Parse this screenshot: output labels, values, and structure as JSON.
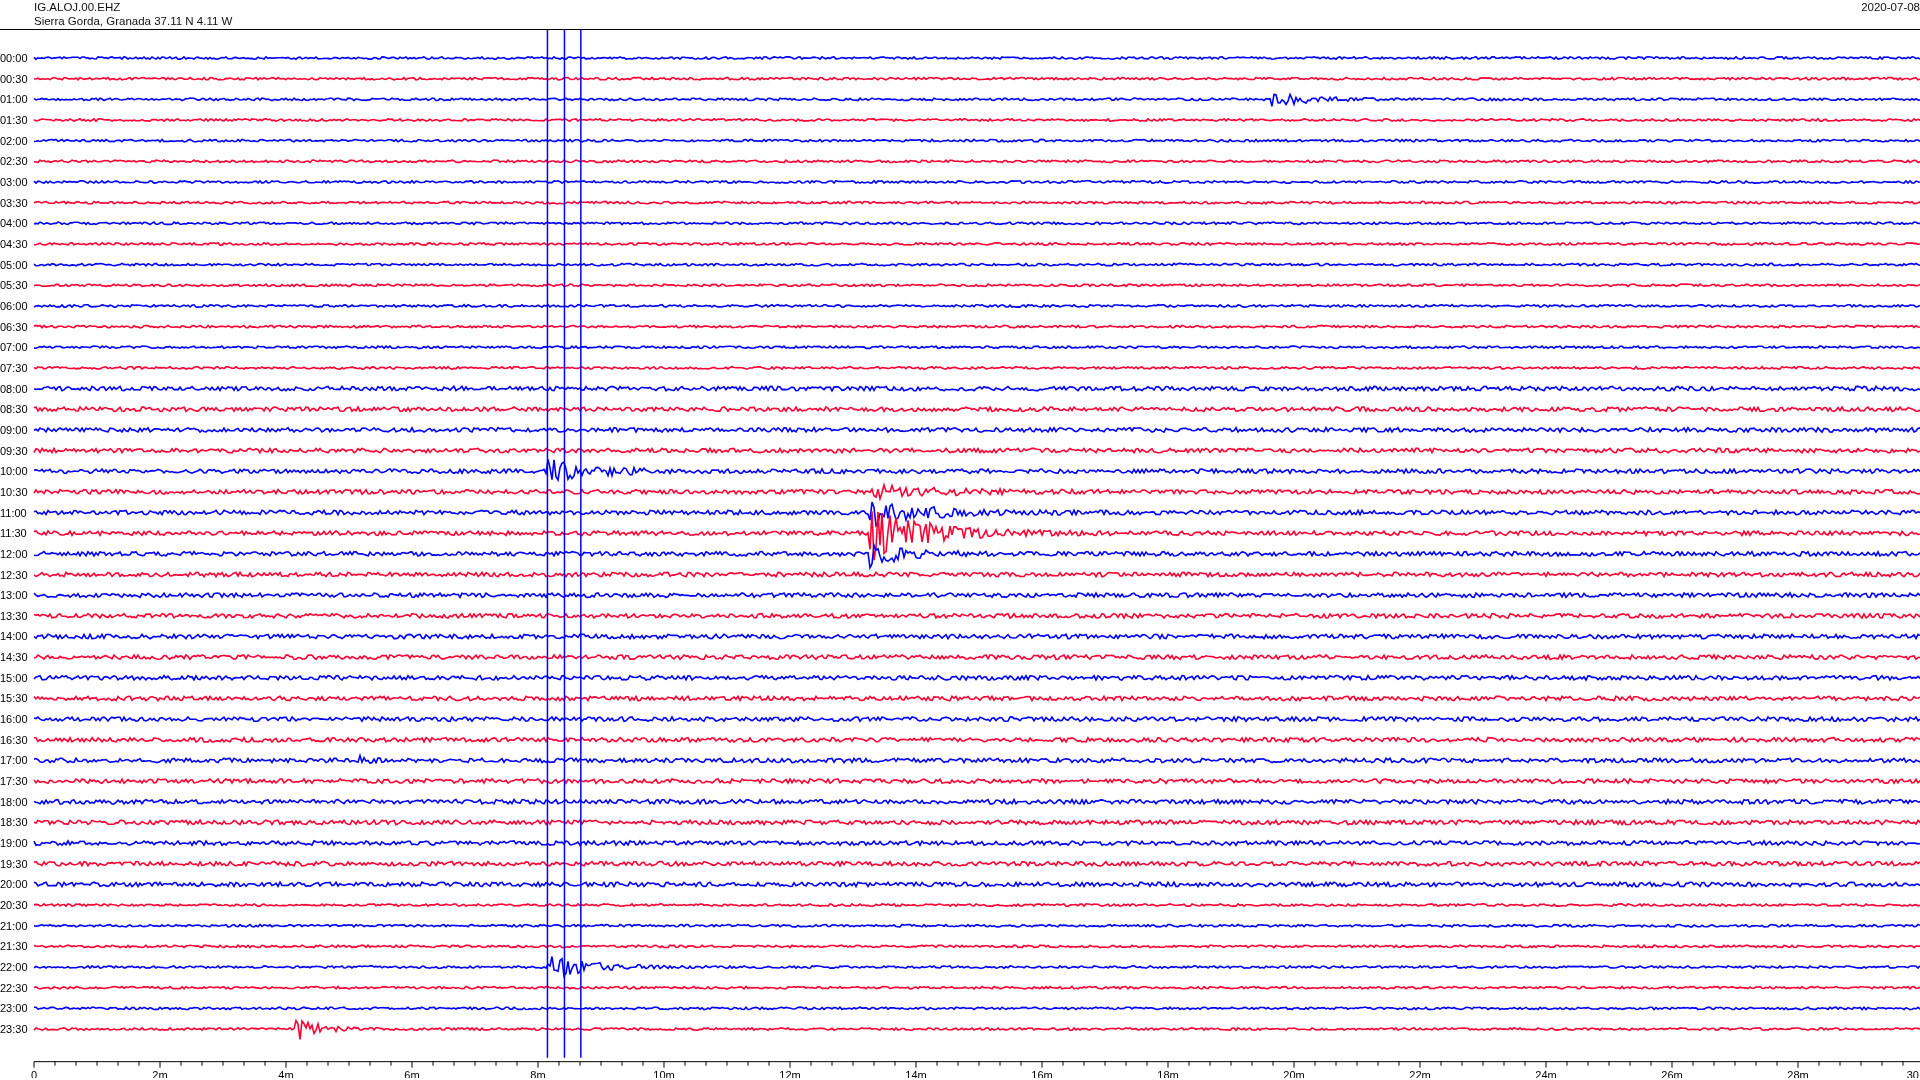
{
  "header": {
    "station": "IG.ALOJ.00.EHZ",
    "location": "Sierra Gorda, Granada  37.11 N 4.11 W",
    "date": "2020-07-08"
  },
  "rows": [
    {
      "label": "00:00",
      "color": "#0000ff"
    },
    {
      "label": "00:30",
      "color": "#ff0033"
    },
    {
      "label": "01:00",
      "color": "#0000ff"
    },
    {
      "label": "01:30",
      "color": "#ff0033"
    },
    {
      "label": "02:00",
      "color": "#0000ff"
    },
    {
      "label": "02:30",
      "color": "#ff0033"
    },
    {
      "label": "03:00",
      "color": "#0000ff"
    },
    {
      "label": "03:30",
      "color": "#ff0033"
    },
    {
      "label": "04:00",
      "color": "#0000ff"
    },
    {
      "label": "04:30",
      "color": "#ff0033"
    },
    {
      "label": "05:00",
      "color": "#0000ff"
    },
    {
      "label": "05:30",
      "color": "#ff0033"
    },
    {
      "label": "06:00",
      "color": "#0000ff"
    },
    {
      "label": "06:30",
      "color": "#ff0033"
    },
    {
      "label": "07:00",
      "color": "#0000ff"
    },
    {
      "label": "07:30",
      "color": "#ff0033"
    },
    {
      "label": "08:00",
      "color": "#0000ff"
    },
    {
      "label": "08:30",
      "color": "#ff0033"
    },
    {
      "label": "09:00",
      "color": "#0000ff"
    },
    {
      "label": "09:30",
      "color": "#ff0033"
    },
    {
      "label": "10:00",
      "color": "#0000ff"
    },
    {
      "label": "10:30",
      "color": "#ff0033"
    },
    {
      "label": "11:00",
      "color": "#0000ff"
    },
    {
      "label": "11:30",
      "color": "#ff0033"
    },
    {
      "label": "12:00",
      "color": "#0000ff"
    },
    {
      "label": "12:30",
      "color": "#ff0033"
    },
    {
      "label": "13:00",
      "color": "#0000ff"
    },
    {
      "label": "13:30",
      "color": "#ff0033"
    },
    {
      "label": "14:00",
      "color": "#0000ff"
    },
    {
      "label": "14:30",
      "color": "#ff0033"
    },
    {
      "label": "15:00",
      "color": "#0000ff"
    },
    {
      "label": "15:30",
      "color": "#ff0033"
    },
    {
      "label": "16:00",
      "color": "#0000ff"
    },
    {
      "label": "16:30",
      "color": "#ff0033"
    },
    {
      "label": "17:00",
      "color": "#0000ff"
    },
    {
      "label": "17:30",
      "color": "#ff0033"
    },
    {
      "label": "18:00",
      "color": "#0000ff"
    },
    {
      "label": "18:30",
      "color": "#ff0033"
    },
    {
      "label": "19:00",
      "color": "#0000ff"
    },
    {
      "label": "19:30",
      "color": "#ff0033"
    },
    {
      "label": "20:00",
      "color": "#0000ff"
    },
    {
      "label": "20:30",
      "color": "#ff0033"
    },
    {
      "label": "21:00",
      "color": "#0000ff"
    },
    {
      "label": "21:30",
      "color": "#ff0033"
    },
    {
      "label": "22:00",
      "color": "#0000ff"
    },
    {
      "label": "22:30",
      "color": "#ff0033"
    },
    {
      "label": "23:00",
      "color": "#0000ff"
    },
    {
      "label": "23:30",
      "color": "#ff0033"
    }
  ],
  "x_axis": {
    "ticks": [
      "0",
      "2m",
      "4m",
      "6m",
      "8m",
      "10m",
      "12m",
      "14m",
      "16m",
      "18m",
      "20m",
      "22m",
      "24m",
      "26m",
      "28m",
      "30"
    ]
  }
}
